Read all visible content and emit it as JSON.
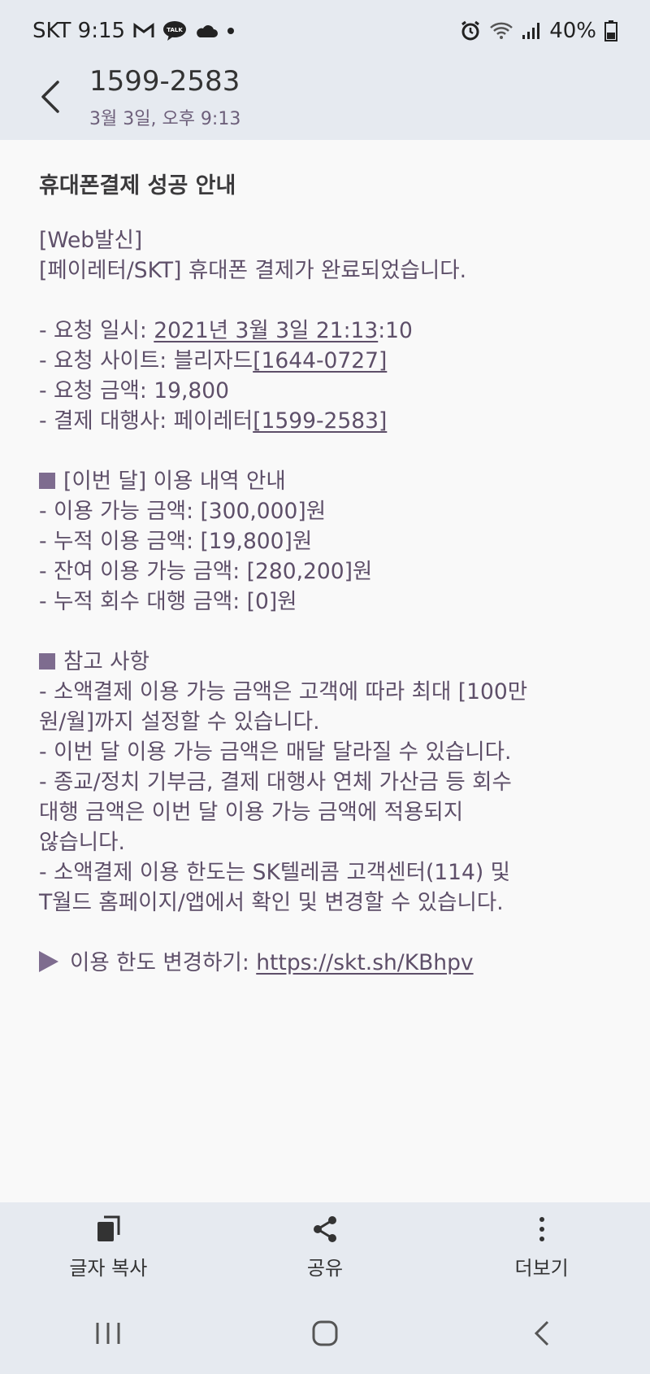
{
  "status_bar": {
    "carrier_time": "SKT 9:15",
    "battery": "40%",
    "icons": [
      "gmail-icon",
      "kakaotalk-icon",
      "cloud-icon",
      "dot-icon",
      "alarm-icon",
      "wifi-icon",
      "signal-icon",
      "battery-icon"
    ]
  },
  "header": {
    "title": "1599-2583",
    "subtitle": "3월 3일, 오후 9:13"
  },
  "message": {
    "title": "휴대폰결제 성공 안내",
    "l1": "[Web발신]",
    "l2": "[페이레터/SKT] 휴대폰 결제가 완료되었습니다.",
    "l3a": "- 요청 일시: ",
    "l3b": "2021년 3월 3일 21:13",
    "l3c": ":10",
    "l4a": "- 요청 사이트: 블리자드",
    "l4b": "[1644-0727]",
    "l5": "- 요청 금액: 19,800",
    "l6a": "- 결제 대행사: 페이레터",
    "l6b": "[1599-2583]",
    "s1": "[이번 달] 이용 내역 안내",
    "l7": "- 이용 가능 금액: [300,000]원",
    "l8": "- 누적 이용 금액: [19,800]원",
    "l9": "- 잔여 이용 가능 금액: [280,200]원",
    "l10": "- 누적 회수 대행 금액: [0]원",
    "s2": "참고 사항",
    "l11": "- 소액결제 이용 가능 금액은 고객에 따라 최대 [100만",
    "l12": "원/월]까지 설정할 수 있습니다.",
    "l13": "- 이번 달 이용 가능 금액은 매달 달라질 수 있습니다.",
    "l14": "- 종교/정치 기부금, 결제 대행사 연체 가산금 등 회수",
    "l15": "대행 금액은 이번 달 이용 가능 금액에 적용되지",
    "l16": "않습니다.",
    "l17": "- 소액결제 이용 한도는 SK텔레콤 고객센터(114) 및",
    "l18": "T월드 홈페이지/앱에서 확인 및 변경할 수 있습니다.",
    "l19a": "이용 한도 변경하기: ",
    "l19b": "https://skt.sh/KBhpv"
  },
  "bottom_bar": {
    "copy": "글자 복사",
    "share": "공유",
    "more": "더보기"
  },
  "colors": {
    "accent": "#7e6c8f",
    "text": "#5e4f69",
    "bar_bg": "#e6eaf0",
    "content_bg": "#f9f9f9"
  }
}
